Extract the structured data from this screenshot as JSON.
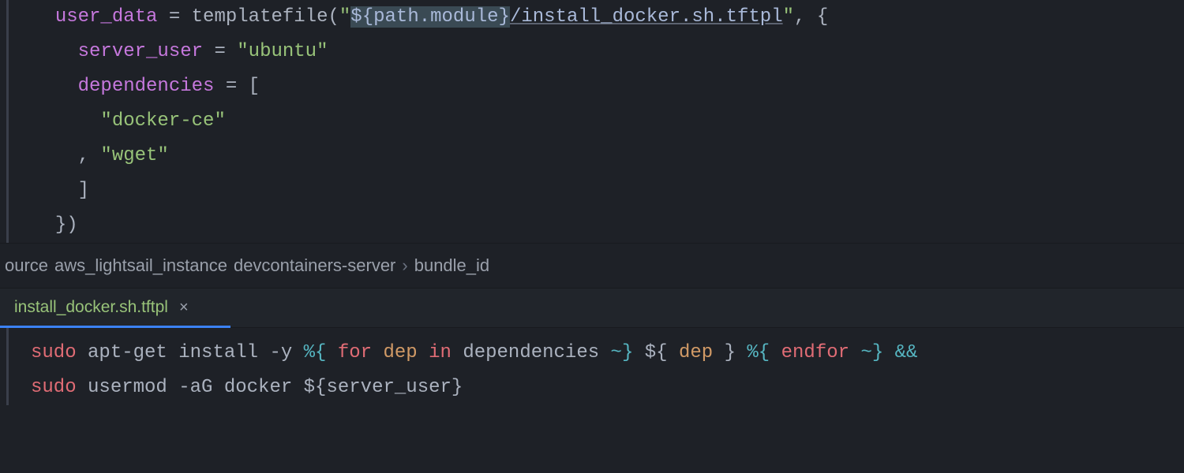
{
  "top": {
    "l1": {
      "attr": "user_data",
      "eq": " = ",
      "fn": "templatefile",
      "paren_open": "(",
      "q1": "\"",
      "interp_open": "${",
      "interp_body": "path.module",
      "interp_close": "}",
      "path_tail": "/install_docker.sh.tftpl",
      "q2": "\"",
      "comma": ", {"
    },
    "l2": {
      "attr": "server_user",
      "eq": " = ",
      "val": "\"ubuntu\""
    },
    "l3": {
      "attr": "dependencies",
      "eq": " = [",
      "close": ""
    },
    "l4": {
      "val": "\"docker-ce\""
    },
    "l5": {
      "comma": ", ",
      "val": "\"wget\""
    },
    "l6": {
      "close": "]"
    },
    "l7": {
      "close": "})"
    }
  },
  "breadcrumb": {
    "a": "ource",
    "b": "aws_lightsail_instance",
    "c": "devcontainers-server",
    "d": "bundle_id"
  },
  "tab": {
    "name": "install_docker.sh.tftpl",
    "close": "×"
  },
  "bottom": {
    "l1": {
      "sudo": "sudo",
      "seg1": " apt-get install -y ",
      "pct1": "%{",
      "for": " for ",
      "dep": "dep",
      "in": " in ",
      "deps": "dependencies ",
      "tilde1": "~}",
      "sp1": " ",
      "dopen": "${",
      "depvar": " dep ",
      "dclose": "}",
      "sp2": " ",
      "pct2": "%{",
      "endfor": " endfor ",
      "tilde2": "~}",
      "and": " &&"
    },
    "l2": {
      "sudo": "sudo",
      "seg1": " usermod -aG docker ",
      "dopen": "${",
      "var": "server_user",
      "dclose": "}"
    }
  }
}
